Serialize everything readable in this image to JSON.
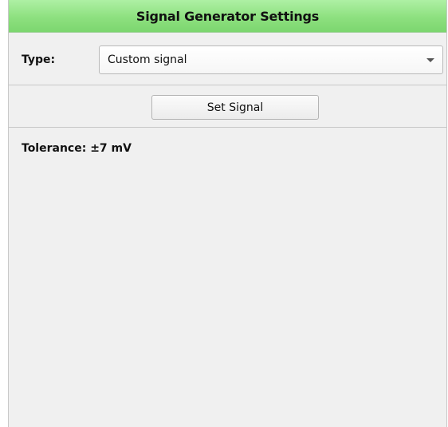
{
  "header": {
    "title": "Signal Generator Settings"
  },
  "type_row": {
    "label": "Type:",
    "select_value": "Custom signal",
    "select_icon": "chevron-down-icon"
  },
  "actions": {
    "set_signal_label": "Set Signal"
  },
  "info": {
    "tolerance_text": "Tolerance: ±7 mV"
  },
  "colors": {
    "header_green": "#8de07f",
    "panel_background": "#f0f0f0",
    "border": "#c8c8c8"
  }
}
